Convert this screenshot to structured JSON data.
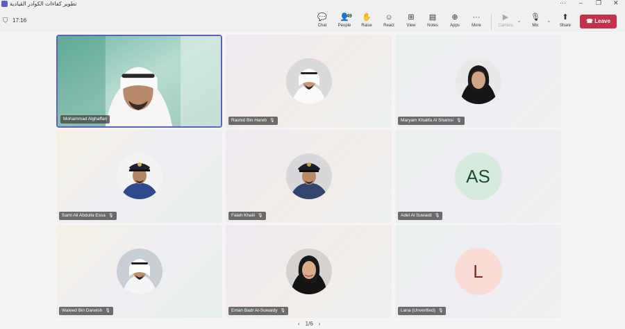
{
  "window": {
    "title": "تطوير كفاءات الكوادر القيادية",
    "controls": {
      "more": "···",
      "minimize": "–",
      "restore": "❐",
      "close": "✕"
    }
  },
  "toolbar": {
    "timer": "17:16",
    "people_count": "49",
    "items": {
      "chat": "Chat",
      "people": "People",
      "raise": "Raise",
      "react": "React",
      "view": "View",
      "notes": "Notes",
      "apps": "Apps",
      "more": "More",
      "camera": "Camera",
      "mic": "Mic",
      "share": "Share"
    },
    "leave_label": "Leave",
    "colors": {
      "leave": "#c4314b",
      "accent": "#5b5fc7"
    }
  },
  "participants": [
    {
      "name": "Mohammad Alghaffari",
      "type": "video",
      "muted": false
    },
    {
      "name": "Rashid Bin Hareb",
      "type": "photo",
      "muted": true
    },
    {
      "name": "Maryam Khalifa Al Shamsi",
      "type": "photo",
      "muted": true
    },
    {
      "name": "Sami Ali Abdulla Essa",
      "type": "photo",
      "muted": true
    },
    {
      "name": "Falah Khalil",
      "type": "photo",
      "muted": true
    },
    {
      "name": "Adel Al Suwaidi",
      "type": "initials",
      "initials": "AS",
      "muted": true
    },
    {
      "name": "Waleed Bin Darwish",
      "type": "photo",
      "muted": true
    },
    {
      "name": "Eman Badr Al-Suwaidy",
      "type": "photo",
      "muted": true
    },
    {
      "name": "Lana (Unverified)",
      "type": "initials",
      "initials": "L",
      "muted": true
    }
  ],
  "pager": {
    "label": "1/6",
    "prev": "‹",
    "next": "›"
  },
  "icons": {
    "mic_muted": "mic-off-icon",
    "shield": "shield-icon"
  }
}
